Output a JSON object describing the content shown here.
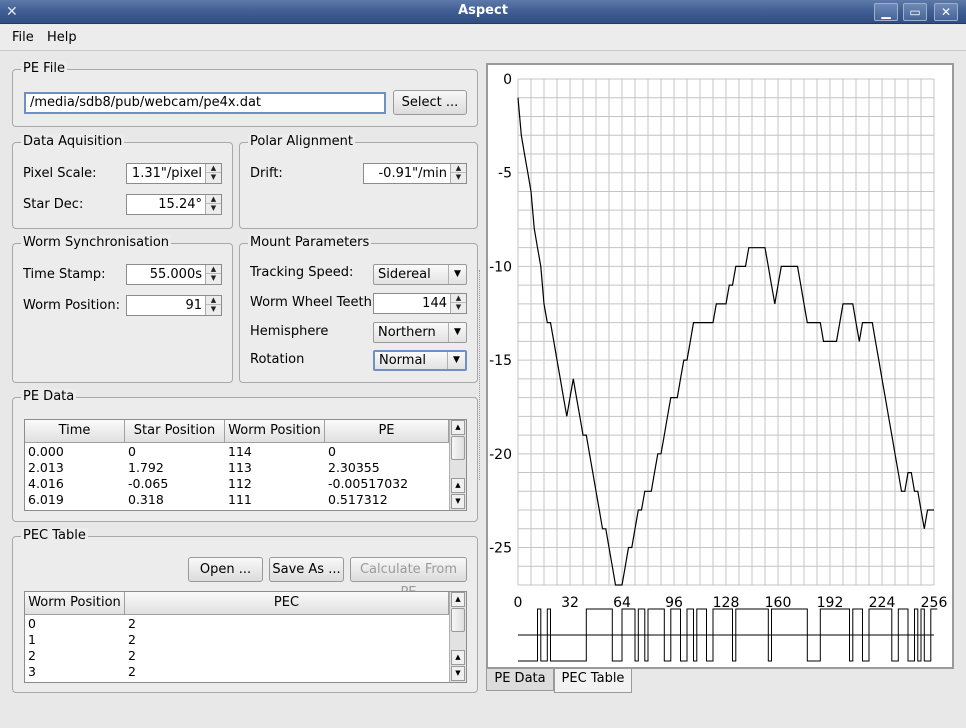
{
  "window": {
    "title": "Aspect",
    "buttons": {
      "minimize": "▁",
      "maximize": "▭",
      "close": "✕"
    }
  },
  "menu": {
    "file": "File",
    "help": "Help"
  },
  "pe_file": {
    "group_title": "PE File",
    "path": "/media/sdb8/pub/webcam/pe4x.dat",
    "select_label": "Select ..."
  },
  "data_aquisition": {
    "group_title": "Data Aquisition",
    "pixel_scale_label": "Pixel Scale:",
    "pixel_scale_value": "1.31\"/pixel",
    "star_dec_label": "Star Dec:",
    "star_dec_value": "15.24°"
  },
  "polar_alignment": {
    "group_title": "Polar Alignment",
    "drift_label": "Drift:",
    "drift_value": "-0.91\"/min"
  },
  "worm_sync": {
    "group_title": "Worm Synchronisation",
    "time_stamp_label": "Time Stamp:",
    "time_stamp_value": "55.000s",
    "worm_position_label": "Worm Position:",
    "worm_position_value": "91"
  },
  "mount": {
    "group_title": "Mount Parameters",
    "tracking_label": "Tracking Speed:",
    "tracking_value": "Sidereal",
    "teeth_label": "Worm Wheel Teeth:",
    "teeth_value": "144",
    "hemisphere_label": "Hemisphere",
    "hemisphere_value": "Northern",
    "rotation_label": "Rotation",
    "rotation_value": "Normal"
  },
  "pe_data": {
    "group_title": "PE Data",
    "columns": [
      "Time",
      "Star Position",
      "Worm Position",
      "PE"
    ],
    "rows": [
      [
        "0.000",
        "0",
        "114",
        "0"
      ],
      [
        "2.013",
        "1.792",
        "113",
        "2.30355"
      ],
      [
        "4.016",
        "-0.065",
        "112",
        "-0.00517032"
      ],
      [
        "6.019",
        "0.318",
        "111",
        "0.517312"
      ]
    ]
  },
  "pec_table": {
    "group_title": "PEC Table",
    "open_label": "Open ...",
    "save_as_label": "Save As ...",
    "calculate_label": "Calculate From PE",
    "columns": [
      "Worm Position",
      "PEC"
    ],
    "rows": [
      [
        "0",
        "2"
      ],
      [
        "1",
        "2"
      ],
      [
        "2",
        "2"
      ],
      [
        "3",
        "2"
      ]
    ]
  },
  "tabs": {
    "pe_data": "PE Data",
    "pec_table": "PEC Table",
    "active": "PEC Table"
  },
  "chart_data": {
    "type": "line",
    "xlim": [
      0,
      256
    ],
    "ylim": [
      -27,
      0
    ],
    "x_ticks": [
      "0",
      "32",
      "64",
      "96",
      "128",
      "160",
      "192",
      "224",
      "256"
    ],
    "y_ticks": [
      "0",
      "-5",
      "-10",
      "-15",
      "-20",
      "-25"
    ],
    "grid": true,
    "series": [
      {
        "x": [
          0,
          2,
          4,
          6,
          8,
          10,
          12,
          14,
          16,
          18,
          20,
          22,
          24,
          26,
          28,
          30,
          32,
          34,
          36,
          38,
          40,
          42,
          44,
          46,
          48,
          50,
          52,
          54,
          56,
          58,
          60,
          62,
          64,
          66,
          68,
          70,
          72,
          74,
          76,
          78,
          80,
          82,
          84,
          86,
          88,
          90,
          92,
          94,
          96,
          98,
          100,
          102,
          104,
          106,
          108,
          110,
          112,
          114,
          116,
          118,
          120,
          122,
          124,
          126,
          128,
          130,
          132,
          134,
          136,
          138,
          140,
          142,
          144,
          146,
          148,
          150,
          152,
          154,
          156,
          158,
          160,
          162,
          164,
          166,
          168,
          170,
          172,
          174,
          176,
          178,
          180,
          182,
          184,
          186,
          188,
          190,
          192,
          194,
          196,
          198,
          200,
          202,
          204,
          206,
          208,
          210,
          212,
          214,
          216,
          218,
          220,
          222,
          224,
          226,
          228,
          230,
          232,
          234,
          236,
          238,
          240,
          242,
          244,
          246,
          248,
          250,
          252,
          254,
          256
        ],
        "y": [
          -1,
          -3,
          -4,
          -5,
          -6,
          -8,
          -9,
          -10,
          -12,
          -13,
          -13,
          -14,
          -15,
          -16,
          -17,
          -18,
          -17,
          -16,
          -17,
          -18,
          -19,
          -19,
          -20,
          -21,
          -22,
          -23,
          -24,
          -24,
          -25,
          -26,
          -27,
          -27,
          -27,
          -26,
          -25,
          -25,
          -24,
          -23,
          -23,
          -22,
          -22,
          -22,
          -21,
          -20,
          -20,
          -19,
          -18,
          -17,
          -17,
          -17,
          -16,
          -15,
          -15,
          -14,
          -13,
          -13,
          -13,
          -13,
          -13,
          -13,
          -13,
          -12,
          -12,
          -12,
          -12,
          -11,
          -11,
          -10,
          -10,
          -10,
          -10,
          -9,
          -9,
          -9,
          -9,
          -9,
          -9,
          -10,
          -11,
          -12,
          -11,
          -10,
          -10,
          -10,
          -10,
          -10,
          -10,
          -11,
          -12,
          -13,
          -13,
          -13,
          -13,
          -13,
          -14,
          -14,
          -14,
          -14,
          -14,
          -13,
          -12,
          -12,
          -12,
          -12,
          -13,
          -14,
          -13,
          -13,
          -13,
          -13,
          -14,
          -15,
          -16,
          -17,
          -18,
          -19,
          -20,
          -21,
          -22,
          -22,
          -21,
          -21,
          -22,
          -22,
          -23,
          -24,
          -23,
          -23,
          -23
        ]
      }
    ],
    "pec_strip": {
      "x_step": 2,
      "levels": [
        0,
        0,
        0,
        0,
        0,
        0,
        1,
        0,
        0,
        1,
        0,
        0,
        0,
        0,
        0,
        0,
        0,
        0,
        0,
        0,
        0,
        1,
        1,
        1,
        1,
        1,
        1,
        1,
        1,
        0,
        0,
        0,
        1,
        1,
        1,
        1,
        0,
        1,
        1,
        0,
        1,
        1,
        1,
        1,
        1,
        0,
        0,
        1,
        1,
        1,
        0,
        0,
        1,
        1,
        0,
        1,
        1,
        1,
        0,
        0,
        1,
        1,
        1,
        1,
        1,
        1,
        0,
        1,
        1,
        1,
        1,
        1,
        1,
        1,
        1,
        1,
        1,
        0,
        1,
        1,
        1,
        1,
        1,
        1,
        1,
        1,
        1,
        1,
        1,
        0,
        0,
        0,
        0,
        1,
        1,
        1,
        1,
        1,
        1,
        1,
        1,
        1,
        0,
        1,
        1,
        1,
        0,
        0,
        1,
        1,
        1,
        1,
        1,
        1,
        1,
        0,
        0,
        1,
        1,
        1,
        0,
        0,
        1,
        0,
        1,
        0,
        0,
        1,
        1
      ]
    }
  }
}
